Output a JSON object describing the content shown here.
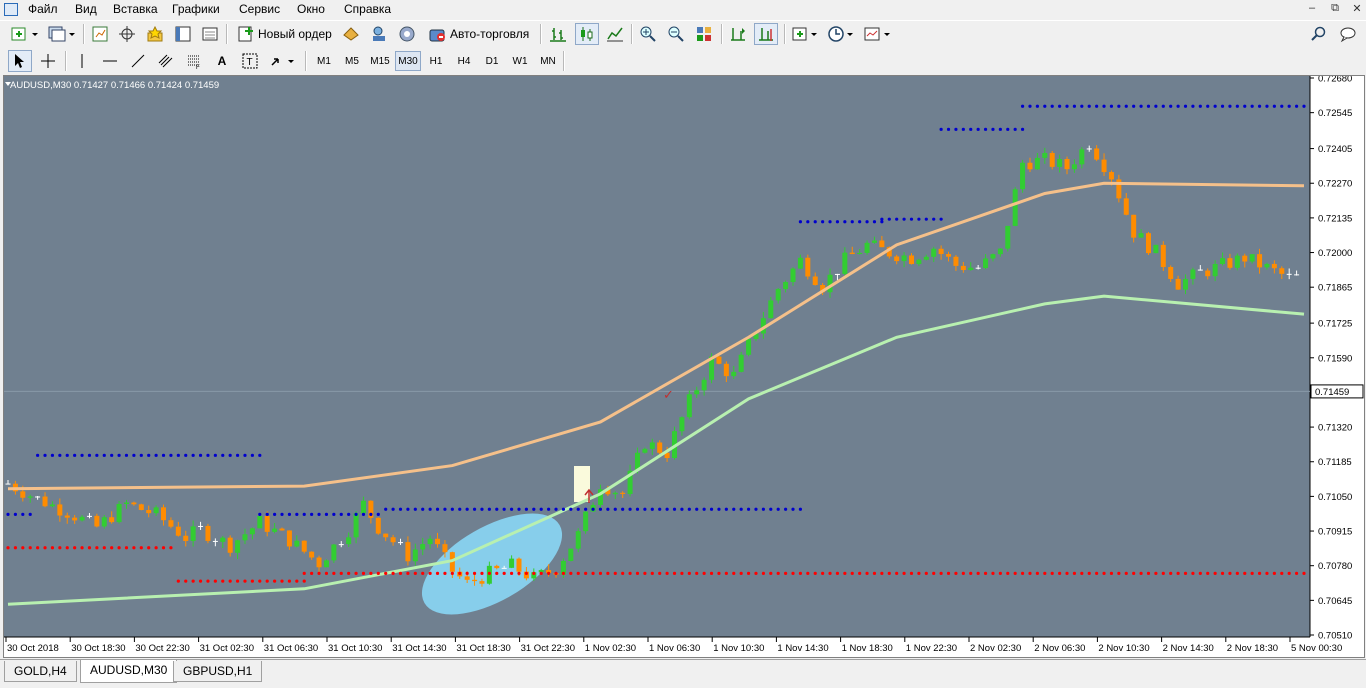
{
  "menu": [
    "Файл",
    "Вид",
    "Вставка",
    "Графики",
    "Сервис",
    "Окно",
    "Справка"
  ],
  "toolbar": {
    "new_order_label": "Новый ордер",
    "autotrading_label": "Авто-торговля"
  },
  "timeframes": [
    "M1",
    "M5",
    "M15",
    "M30",
    "H1",
    "H4",
    "D1",
    "W1",
    "MN"
  ],
  "active_timeframe": "M30",
  "chart": {
    "title": "AUDUSD,M30  0.71427 0.71466 0.71424 0.71459",
    "current_price_label": "0.71459",
    "background_color": "#708090",
    "bull_color": "#32cd32",
    "bear_color": "#ff8c00",
    "doji_color": "#ffffff",
    "sar_upper_color": "#0000cd",
    "sar_lower_color": "#ff0000",
    "ma_fast_color": "#f5c08a",
    "ma_slow_color": "#b8f0b0",
    "highlight_ellipse_color": "#87ceeb"
  },
  "chart_data": {
    "type": "candlestick",
    "symbol": "AUDUSD",
    "timeframe": "M30",
    "ohlc_header": [
      0.71427,
      0.71466,
      0.71424,
      0.71459
    ],
    "y_ticks": [
      "0.72680",
      "0.72545",
      "0.72405",
      "0.72270",
      "0.72135",
      "0.72000",
      "0.71865",
      "0.71725",
      "0.71590",
      "0.71455",
      "0.71320",
      "0.71185",
      "0.71050",
      "0.70915",
      "0.70780",
      "0.70645",
      "0.70510"
    ],
    "ylim": [
      0.7051,
      0.7268
    ],
    "x_ticks": [
      "30 Oct 2018",
      "30 Oct 18:30",
      "30 Oct 22:30",
      "31 Oct 02:30",
      "31 Oct 06:30",
      "31 Oct 10:30",
      "31 Oct 14:30",
      "31 Oct 18:30",
      "31 Oct 22:30",
      "1 Nov 02:30",
      "1 Nov 06:30",
      "1 Nov 10:30",
      "1 Nov 14:30",
      "1 Nov 18:30",
      "1 Nov 22:30",
      "2 Nov 02:30",
      "2 Nov 06:30",
      "2 Nov 10:30",
      "2 Nov 14:30",
      "2 Nov 18:30",
      "5 Nov 00:30"
    ],
    "close_path": [
      [
        0,
        0.711
      ],
      [
        4,
        0.7104
      ],
      [
        8,
        0.7099
      ],
      [
        12,
        0.7093
      ],
      [
        16,
        0.7102
      ],
      [
        20,
        0.7098
      ],
      [
        24,
        0.7089
      ],
      [
        26,
        0.7092
      ],
      [
        30,
        0.7086
      ],
      [
        34,
        0.7095
      ],
      [
        38,
        0.7088
      ],
      [
        42,
        0.7079
      ],
      [
        46,
        0.7092
      ],
      [
        48,
        0.7102
      ],
      [
        50,
        0.7093
      ],
      [
        54,
        0.7082
      ],
      [
        57,
        0.7089
      ],
      [
        60,
        0.7076
      ],
      [
        62,
        0.7071
      ],
      [
        65,
        0.7075
      ],
      [
        68,
        0.7078
      ],
      [
        71,
        0.7073
      ],
      [
        74,
        0.7077
      ],
      [
        77,
        0.709
      ],
      [
        80,
        0.711
      ],
      [
        83,
        0.7106
      ],
      [
        86,
        0.7126
      ],
      [
        89,
        0.7122
      ],
      [
        92,
        0.7142
      ],
      [
        95,
        0.7158
      ],
      [
        98,
        0.7152
      ],
      [
        101,
        0.717
      ],
      [
        104,
        0.7186
      ],
      [
        107,
        0.7197
      ],
      [
        110,
        0.7187
      ],
      [
        113,
        0.7197
      ],
      [
        116,
        0.7203
      ],
      [
        119,
        0.72
      ],
      [
        122,
        0.7198
      ],
      [
        125,
        0.7202
      ],
      [
        128,
        0.7195
      ],
      [
        131,
        0.7194
      ],
      [
        134,
        0.72
      ],
      [
        137,
        0.7235
      ],
      [
        140,
        0.7236
      ],
      [
        143,
        0.7233
      ],
      [
        146,
        0.7243
      ],
      [
        149,
        0.723
      ],
      [
        152,
        0.7208
      ],
      [
        155,
        0.72
      ],
      [
        158,
        0.7188
      ],
      [
        161,
        0.7192
      ],
      [
        164,
        0.7195
      ],
      [
        167,
        0.7198
      ],
      [
        170,
        0.7194
      ],
      [
        173,
        0.719
      ]
    ],
    "series": [
      {
        "name": "",
        "type": "moving-average",
        "values": [
          [
            0,
            0.7108
          ],
          [
            40,
            0.7109
          ],
          [
            60,
            0.7117
          ],
          [
            80,
            0.7134
          ],
          [
            100,
            0.7167
          ],
          [
            120,
            0.7203
          ],
          [
            140,
            0.7223
          ],
          [
            148,
            0.7227
          ],
          [
            175,
            0.7226
          ]
        ]
      },
      {
        "name": "",
        "type": "moving-average",
        "values": [
          [
            0,
            0.7063
          ],
          [
            40,
            0.7069
          ],
          [
            60,
            0.708
          ],
          [
            80,
            0.7106
          ],
          [
            100,
            0.7143
          ],
          [
            120,
            0.7167
          ],
          [
            140,
            0.718
          ],
          [
            148,
            0.7183
          ],
          [
            175,
            0.7176
          ]
        ]
      },
      {
        "name": "",
        "type": "parabolic-sar",
        "segments": [
          {
            "x": [
              0,
              3
            ],
            "y": 0.7098,
            "side": "upper"
          },
          {
            "x": [
              4,
              34
            ],
            "y": 0.7121,
            "side": "upper"
          },
          {
            "x": [
              34,
              50
            ],
            "y": 0.7098,
            "side": "upper"
          },
          {
            "x": [
              51,
              107
            ],
            "y": 0.71,
            "side": "upper"
          },
          {
            "x": [
              107,
              118
            ],
            "y": 0.7212,
            "side": "upper"
          },
          {
            "x": [
              118,
              126
            ],
            "y": 0.7213,
            "side": "upper"
          },
          {
            "x": [
              126,
              137
            ],
            "y": 0.7248,
            "side": "upper"
          },
          {
            "x": [
              137,
              175
            ],
            "y": 0.7257,
            "side": "upper"
          },
          {
            "x": [
              0,
              22
            ],
            "y": 0.7085,
            "side": "lower"
          },
          {
            "x": [
              23,
              40
            ],
            "y": 0.7072,
            "side": "lower"
          },
          {
            "x": [
              40,
              175
            ],
            "y": 0.7075,
            "side": "lower"
          }
        ]
      }
    ],
    "annotations": [
      "check-mark",
      "up-arrow"
    ]
  },
  "tabs": [
    "GOLD,H4",
    "AUDUSD,M30",
    "GBPUSD,H1"
  ],
  "active_tab": "AUDUSD,M30"
}
